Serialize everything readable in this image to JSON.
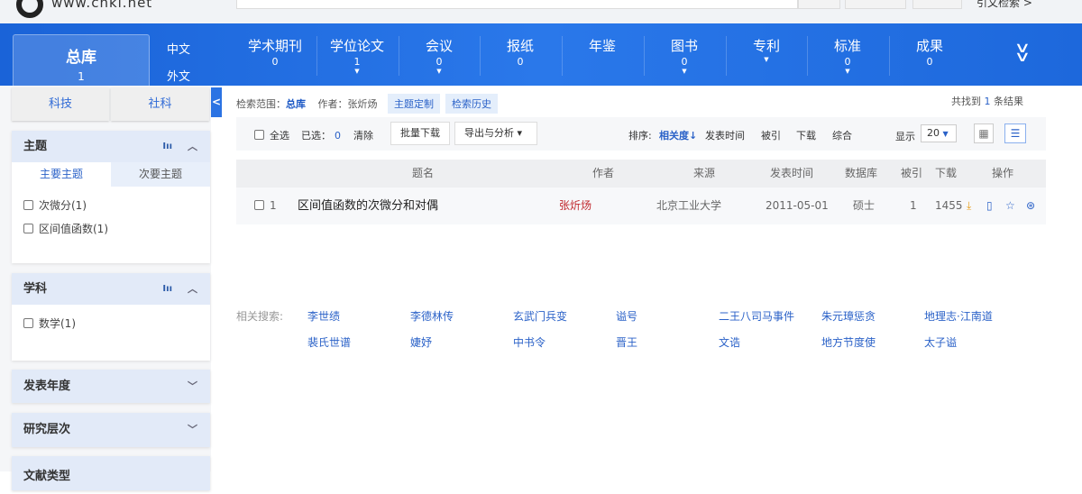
{
  "header": {
    "logo_url": "www.cnki.net",
    "citation_search": "引文检索 >"
  },
  "nav": {
    "all": {
      "label": "总库",
      "count": "1"
    },
    "lang": [
      "中文",
      "外文"
    ],
    "categories": [
      {
        "label": "学术期刊",
        "count": "0",
        "arrow": false
      },
      {
        "label": "学位论文",
        "count": "1",
        "arrow": true
      },
      {
        "label": "会议",
        "count": "0",
        "arrow": true
      },
      {
        "label": "报纸",
        "count": "0",
        "arrow": false
      },
      {
        "label": "年鉴",
        "count": "",
        "arrow": false
      },
      {
        "label": "图书",
        "count": "0",
        "arrow": true
      },
      {
        "label": "专利",
        "count": "",
        "arrow": true
      },
      {
        "label": "标准",
        "count": "0",
        "arrow": true
      },
      {
        "label": "成果",
        "count": "0",
        "arrow": false
      }
    ]
  },
  "sidebar": {
    "tabs": [
      "科技",
      "社科"
    ],
    "topic": {
      "title": "主题",
      "subtabs": [
        "主要主题",
        "次要主题"
      ],
      "items": [
        "次微分(1)",
        "区间值函数(1)"
      ]
    },
    "subject": {
      "title": "学科",
      "items": [
        "数学(1)"
      ]
    },
    "collapsed": [
      "发表年度",
      "研究层次",
      "文献类型"
    ]
  },
  "scope": {
    "label": "检索范围：",
    "value": "总库",
    "author": "作者：张炘炀",
    "custom": "主题定制",
    "history": "检索历史"
  },
  "found": {
    "prefix": "共找到",
    "count": "1",
    "suffix": "条结果"
  },
  "toolbar": {
    "select_all": "全选",
    "selected_label": "已选：",
    "selected": "0",
    "clear": "清除",
    "batch_download": "批量下载",
    "export": "导出与分析 ▾",
    "sort_label": "排序:",
    "sorts": [
      "相关度",
      "发表时间",
      "被引",
      "下载",
      "综合"
    ],
    "display_label": "显示",
    "page_size": "20"
  },
  "table": {
    "headers": [
      "题名",
      "作者",
      "来源",
      "发表时间",
      "数据库",
      "被引",
      "下载",
      "操作"
    ],
    "rows": [
      {
        "index": "1",
        "title": "区间值函数的次微分和对偶",
        "author": "张炘炀",
        "source": "北京工业大学",
        "date": "2011-05-01",
        "db": "硕士",
        "cited": "1",
        "downloads": "1455"
      }
    ]
  },
  "related": {
    "label": "相关搜索:",
    "terms": [
      "李世绩",
      "李德林传",
      "玄武门兵变",
      "谥号",
      "二王八司马事件",
      "朱元璋惩贪",
      "地理志·江南道",
      "裴氏世谱",
      "婕妤",
      "中书令",
      "晋王",
      "文诰",
      "地方节度使",
      "太子谥"
    ]
  },
  "colors": {
    "nav": "#1f6ae0",
    "link": "#2b62c8",
    "author": "#c0262b"
  }
}
